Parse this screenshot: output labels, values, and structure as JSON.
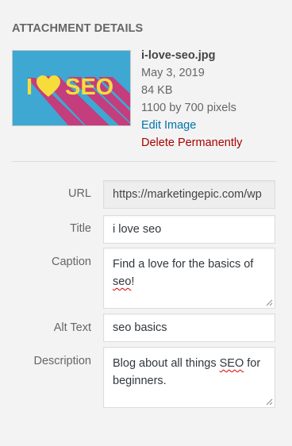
{
  "section_title": "ATTACHMENT DETAILS",
  "thumbnail": {
    "text_i": "I",
    "text_seo": "SEO",
    "colors": {
      "background": "#3ea8d2",
      "text": "#f6dd3b",
      "shadow": "#c43d7d"
    }
  },
  "meta": {
    "filename": "i-love-seo.jpg",
    "date": "May 3, 2019",
    "size": "84 KB",
    "dimensions": "1100 by 700 pixels",
    "edit_label": "Edit Image",
    "delete_label": "Delete Permanently"
  },
  "fields": {
    "url": {
      "label": "URL",
      "value": "https://marketingepic.com/wp"
    },
    "title": {
      "label": "Title",
      "value": "i love seo"
    },
    "caption": {
      "label": "Caption",
      "value_before": "Find a love for the basics of ",
      "value_misspelled": "seo",
      "value_after": "!"
    },
    "alt_text": {
      "label": "Alt Text",
      "value": "seo basics"
    },
    "description": {
      "label": "Description",
      "value_before": "Blog about all things ",
      "value_misspelled": "SEO",
      "value_after": " for beginners."
    }
  },
  "colors": {
    "link": "#0073aa",
    "delete": "#aa0000",
    "spellcheck": "#dd0000"
  }
}
